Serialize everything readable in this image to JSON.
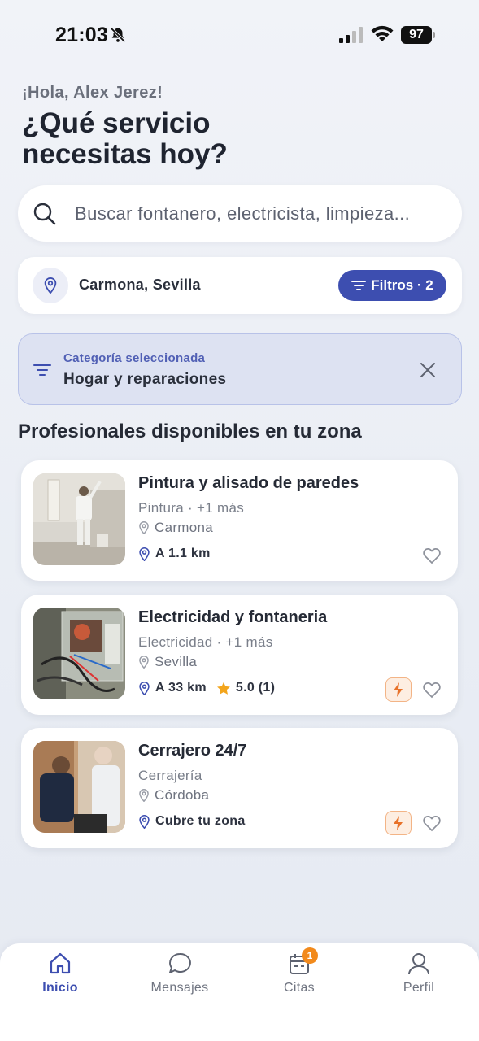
{
  "status_bar": {
    "time": "21:03",
    "battery": "97"
  },
  "greeting": "¡Hola, Alex Jerez!",
  "headline": "¿Qué servicio necesitas hoy?",
  "search": {
    "placeholder": "Buscar fontanero, electricista, limpieza..."
  },
  "location": {
    "text": "Carmona, Sevilla",
    "filters_label": "Filtros · 2"
  },
  "category": {
    "label": "Categoría seleccionada",
    "value": "Hogar y reparaciones"
  },
  "section_title": "Profesionales disponibles en tu zona",
  "cards": [
    {
      "title": "Pintura y alisado de paredes",
      "subtitle": "Pintura · +1 más",
      "city": "Carmona",
      "distance": "A 1.1 km",
      "rating": "",
      "express": false
    },
    {
      "title": "Electricidad y fontaneria",
      "subtitle": "Electricidad · +1 más",
      "city": "Sevilla",
      "distance": "A 33 km",
      "rating": "5.0 (1)",
      "express": true
    },
    {
      "title": "Cerrajero 24/7",
      "subtitle": "Cerrajería",
      "city": "Córdoba",
      "distance": "Cubre tu zona",
      "rating": "",
      "express": true
    }
  ],
  "tabs": [
    {
      "label": "Inicio",
      "icon": "home-icon",
      "active": true
    },
    {
      "label": "Mensajes",
      "icon": "chat-icon",
      "active": false
    },
    {
      "label": "Citas",
      "icon": "calendar-icon",
      "badge": "1",
      "active": false
    },
    {
      "label": "Perfil",
      "icon": "user-icon",
      "active": false
    }
  ],
  "colors": {
    "accent": "#3d4eb0",
    "orange": "#f28a1c",
    "background": "#eef1f6"
  }
}
